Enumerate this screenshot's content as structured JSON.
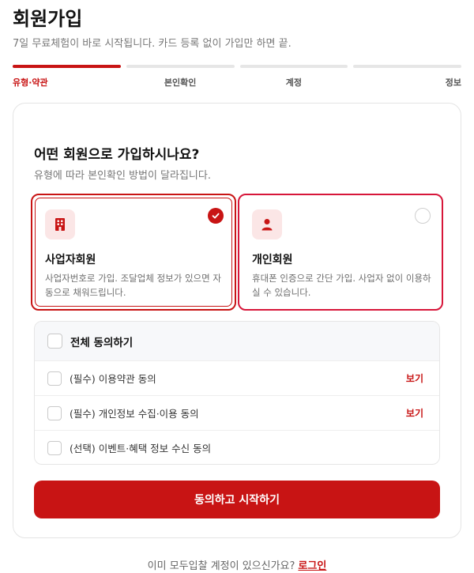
{
  "page": {
    "title": "회원가입",
    "subtitle": "7일 무료체험이 바로 시작됩니다. 카드 등록 없이 가입만 하면 끝."
  },
  "steps": [
    {
      "label": "유형·약관",
      "active": true
    },
    {
      "label": "본인확인",
      "active": false
    },
    {
      "label": "계정",
      "active": false
    },
    {
      "label": "정보",
      "active": false
    }
  ],
  "question": {
    "title": "어떤 회원으로 가입하시나요?",
    "subtitle": "유형에 따라 본인확인 방법이 달라집니다."
  },
  "member_types": [
    {
      "name": "사업자회원",
      "desc": "사업자번호로 가입. 조달업체 정보가 있으면 자동으로 채워드립니다.",
      "icon": "building-icon",
      "selected": true
    },
    {
      "name": "개인회원",
      "desc": "휴대폰 인증으로 간단 가입. 사업자 없이 이용하실 수 있습니다.",
      "icon": "person-icon",
      "selected": false
    }
  ],
  "agreements": {
    "all_label": "전체 동의하기",
    "view_label": "보기",
    "items": [
      {
        "label": "(필수) 이용약관 동의",
        "has_view": true
      },
      {
        "label": "(필수) 개인정보 수집·이용 동의",
        "has_view": true
      },
      {
        "label": "(선택) 이벤트·혜택 정보 수신 동의",
        "has_view": false
      }
    ]
  },
  "cta_label": "동의하고 시작하기",
  "footer": {
    "text": "이미 모두입찰 계정이 있으신가요?",
    "login_label": "로그인"
  },
  "colors": {
    "accent": "#c81414",
    "icon_bg": "#fbe6e6"
  }
}
